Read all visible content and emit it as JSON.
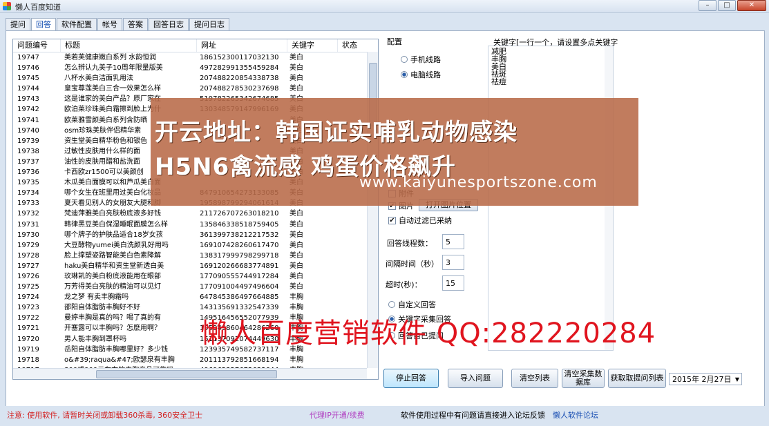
{
  "window": {
    "title": "懒人百度知道",
    "min": "–",
    "max": "□",
    "close": "✕"
  },
  "tabs": [
    "提问",
    "回答",
    "软件配置",
    "帐号",
    "答案",
    "回答日志",
    "提问日志"
  ],
  "list": {
    "columns": [
      "问题编号",
      "标题",
      "网址",
      "关键字",
      "状态"
    ],
    "rows": [
      [
        "19747",
        "美若芙健康嫩白系列 水韵恒润",
        "186152300117032130",
        "美白"
      ],
      [
        "19746",
        "怎么辨认九美子10周年限量版美",
        "497282991355459284",
        "美白"
      ],
      [
        "19745",
        "八杯水美白洁面乳用法",
        "207488220854338738",
        "美白"
      ],
      [
        "19744",
        "皇宝尊莲美白三合一效果怎么样",
        "207488278530237698",
        "美白"
      ],
      [
        "19743",
        "这是谁家的美白产品？原厂家在",
        "519782265342674685",
        "美白"
      ],
      [
        "19742",
        "欧泊莱珍珠美白霜擦到脸上为什",
        "130348579147996169",
        "美白"
      ],
      [
        "19741",
        "欧莱雅雪颜美白系列含防晒",
        "",
        "美白"
      ],
      [
        "19740",
        "osm珍珠美肤伴侣精华素",
        "",
        "美白"
      ],
      [
        "19739",
        "资生堂美白精华粉色和银色",
        "",
        "美白"
      ],
      [
        "19738",
        "过敏性皮肤用什么样的面",
        "",
        "美白"
      ],
      [
        "19737",
        "油性的皮肤用醋和盐洗面",
        "",
        "美白"
      ],
      [
        "19736",
        "卡西欧zr1500可以美颜创",
        "",
        "美白"
      ],
      [
        "19735",
        "木瓜美白面膜可以和芦瓜美白面",
        "",
        "美白"
      ],
      [
        "19734",
        "哪个女生在班里用过美白化妆品",
        "847910654273133085",
        "美白"
      ],
      [
        "19733",
        "夏天看见别人的女朋友大腿和脚",
        "195898799294061614",
        "美白"
      ],
      [
        "19732",
        "梵迪萍雅美白亮肤粉底液多好钱",
        "211726707263018210",
        "美白"
      ],
      [
        "19731",
        "韩律黑豆美白保湿睡眠面膜怎么样",
        "135846338518759405",
        "美白"
      ],
      [
        "19730",
        "哪个牌子的护肤品适合18岁女孩",
        "361399738212217532",
        "美白"
      ],
      [
        "19729",
        "大豆酵物yumei美白洗颜乳好用吗",
        "169107428260617470",
        "美白"
      ],
      [
        "19728",
        "脸上撑塑姿路智能美白色素降解",
        "138317999798299718",
        "美白"
      ],
      [
        "19727",
        "haku美白精华和资生堂新透白美",
        "169120266683774891",
        "美白"
      ],
      [
        "19726",
        "玫琳凯的美白粉底液能用在眼部",
        "177090555744917284",
        "美白"
      ],
      [
        "19725",
        "万芳得美白亮肤的精油可以见灯",
        "177091004497496604",
        "美白"
      ],
      [
        "19724",
        "龙之梦 有卖丰胸霜吗",
        "647845386497664885",
        "丰胸"
      ],
      [
        "19723",
        "邵阳自体脂肪丰胸好不好",
        "143135691332547339",
        "丰胸"
      ],
      [
        "19722",
        "曼婷丰胸是真的吗？喝了真的有",
        "149516456552077939",
        "丰胸"
      ],
      [
        "19721",
        "开塞露可以丰胸吗？怎麽用啊？",
        "195949860464286260",
        "丰胸"
      ],
      [
        "19720",
        "男人能丰胸到罩杯吗",
        "151137092074449630",
        "丰胸"
      ],
      [
        "19719",
        "岳阳自体脂肪丰胸哪里好？多少钱",
        "123935749582737117",
        "丰胸"
      ],
      [
        "19718",
        "o&#39;raqua&#47;欧瑟泉有丰胸",
        "201113792851668194",
        "丰胸"
      ],
      [
        "19717",
        "800或900元左右的丰胸产品可靠吗",
        "496962327672633644",
        "丰胸"
      ]
    ]
  },
  "config": {
    "label": "配置",
    "mobile_route": "手机线路",
    "pc_route": "电脑线路",
    "attach_label": "附件",
    "image_label": "图片",
    "open_image_btn": "打开图片位置",
    "auto_filter": "自动过滤已采纳",
    "threads_label": "回答线程数：",
    "threads_value": "5",
    "interval_label": "间隔时间（秒）",
    "interval_value": "3",
    "timeout_label": "超时(秒)：",
    "timeout_value": "15",
    "custom_answer": "自定义回答",
    "keyword_answer": "关键字采集回答",
    "self_answer": "回答自己提问"
  },
  "keywords": {
    "label": "关键字[一行一个，请设置多点关键字",
    "items": [
      "减肥",
      "丰胸",
      "美白",
      "祛斑",
      "祛痘"
    ]
  },
  "buttons": {
    "stop": "停止回答",
    "import": "导入问题",
    "clear": "清空列表",
    "clear_db_line1": "清空采集数",
    "clear_db_line2": "据库",
    "get_list": "获取取提问列表"
  },
  "date": "2015年  2月27日",
  "status": {
    "notice": "注意: 使用软件, 请暂时关闭或卸载360杀毒, 360安全卫士",
    "proxy": "代理IP开通/续费",
    "feedback": "软件使用过程中有问题请直接进入论坛反馈",
    "forum": "懒人软件论坛"
  },
  "overlay": {
    "line1": "开云地址：韩国证实哺乳动物感染",
    "line2": "H5N6禽流感 鸡蛋价格飙升",
    "url": "www.kaiyunesportszone.com",
    "watermark": "懒人百度营销软件 QQ:282220284"
  }
}
